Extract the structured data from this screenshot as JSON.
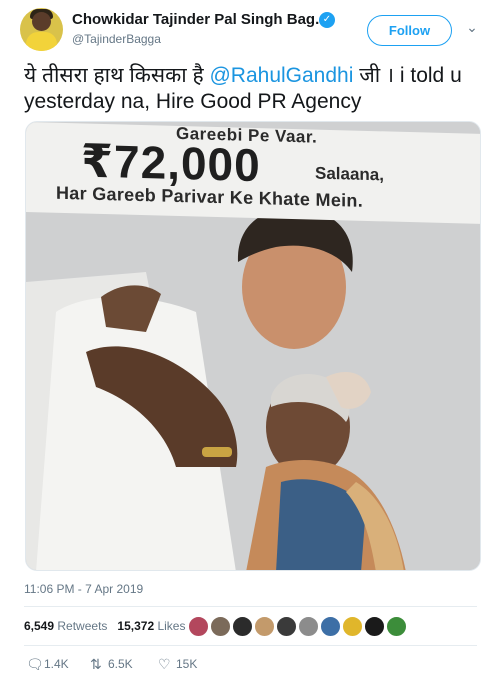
{
  "tweet": {
    "author": {
      "name": "Chowkidar Tajinder Pal Singh Bag...",
      "handle": "@TajinderBagga",
      "verified": true,
      "avatar_icon": "profile-avatar"
    },
    "follow_label": "Follow",
    "menu_icon": "chevron-down-icon",
    "text": {
      "before": "ये तीसरा हाथ किसका है ",
      "mention": "@RahulGandhi",
      "after": " जी । i told u yesterday na, Hire Good PR Agency"
    },
    "media": {
      "billboard": {
        "line1": "Gareebi Pe Vaar.",
        "amount": "₹72,000",
        "amount_suffix": "Salaana,",
        "line3": "Har Gareeb Parivar Ke Khate Mein."
      }
    },
    "timestamp": "11:06 PM - 7 Apr 2019",
    "retweets": {
      "count": "6,549",
      "label": "Retweets"
    },
    "likes": {
      "count": "15,372",
      "label": "Likes"
    },
    "engager_avatar_count": 10,
    "actions": {
      "reply": "1.4K",
      "retweet": "6.5K",
      "like": "15K"
    }
  },
  "colors": {
    "accent": "#1da1f2",
    "mention": "#1b95e0",
    "secondary_text": "#657786",
    "primary_text": "#14171a"
  }
}
